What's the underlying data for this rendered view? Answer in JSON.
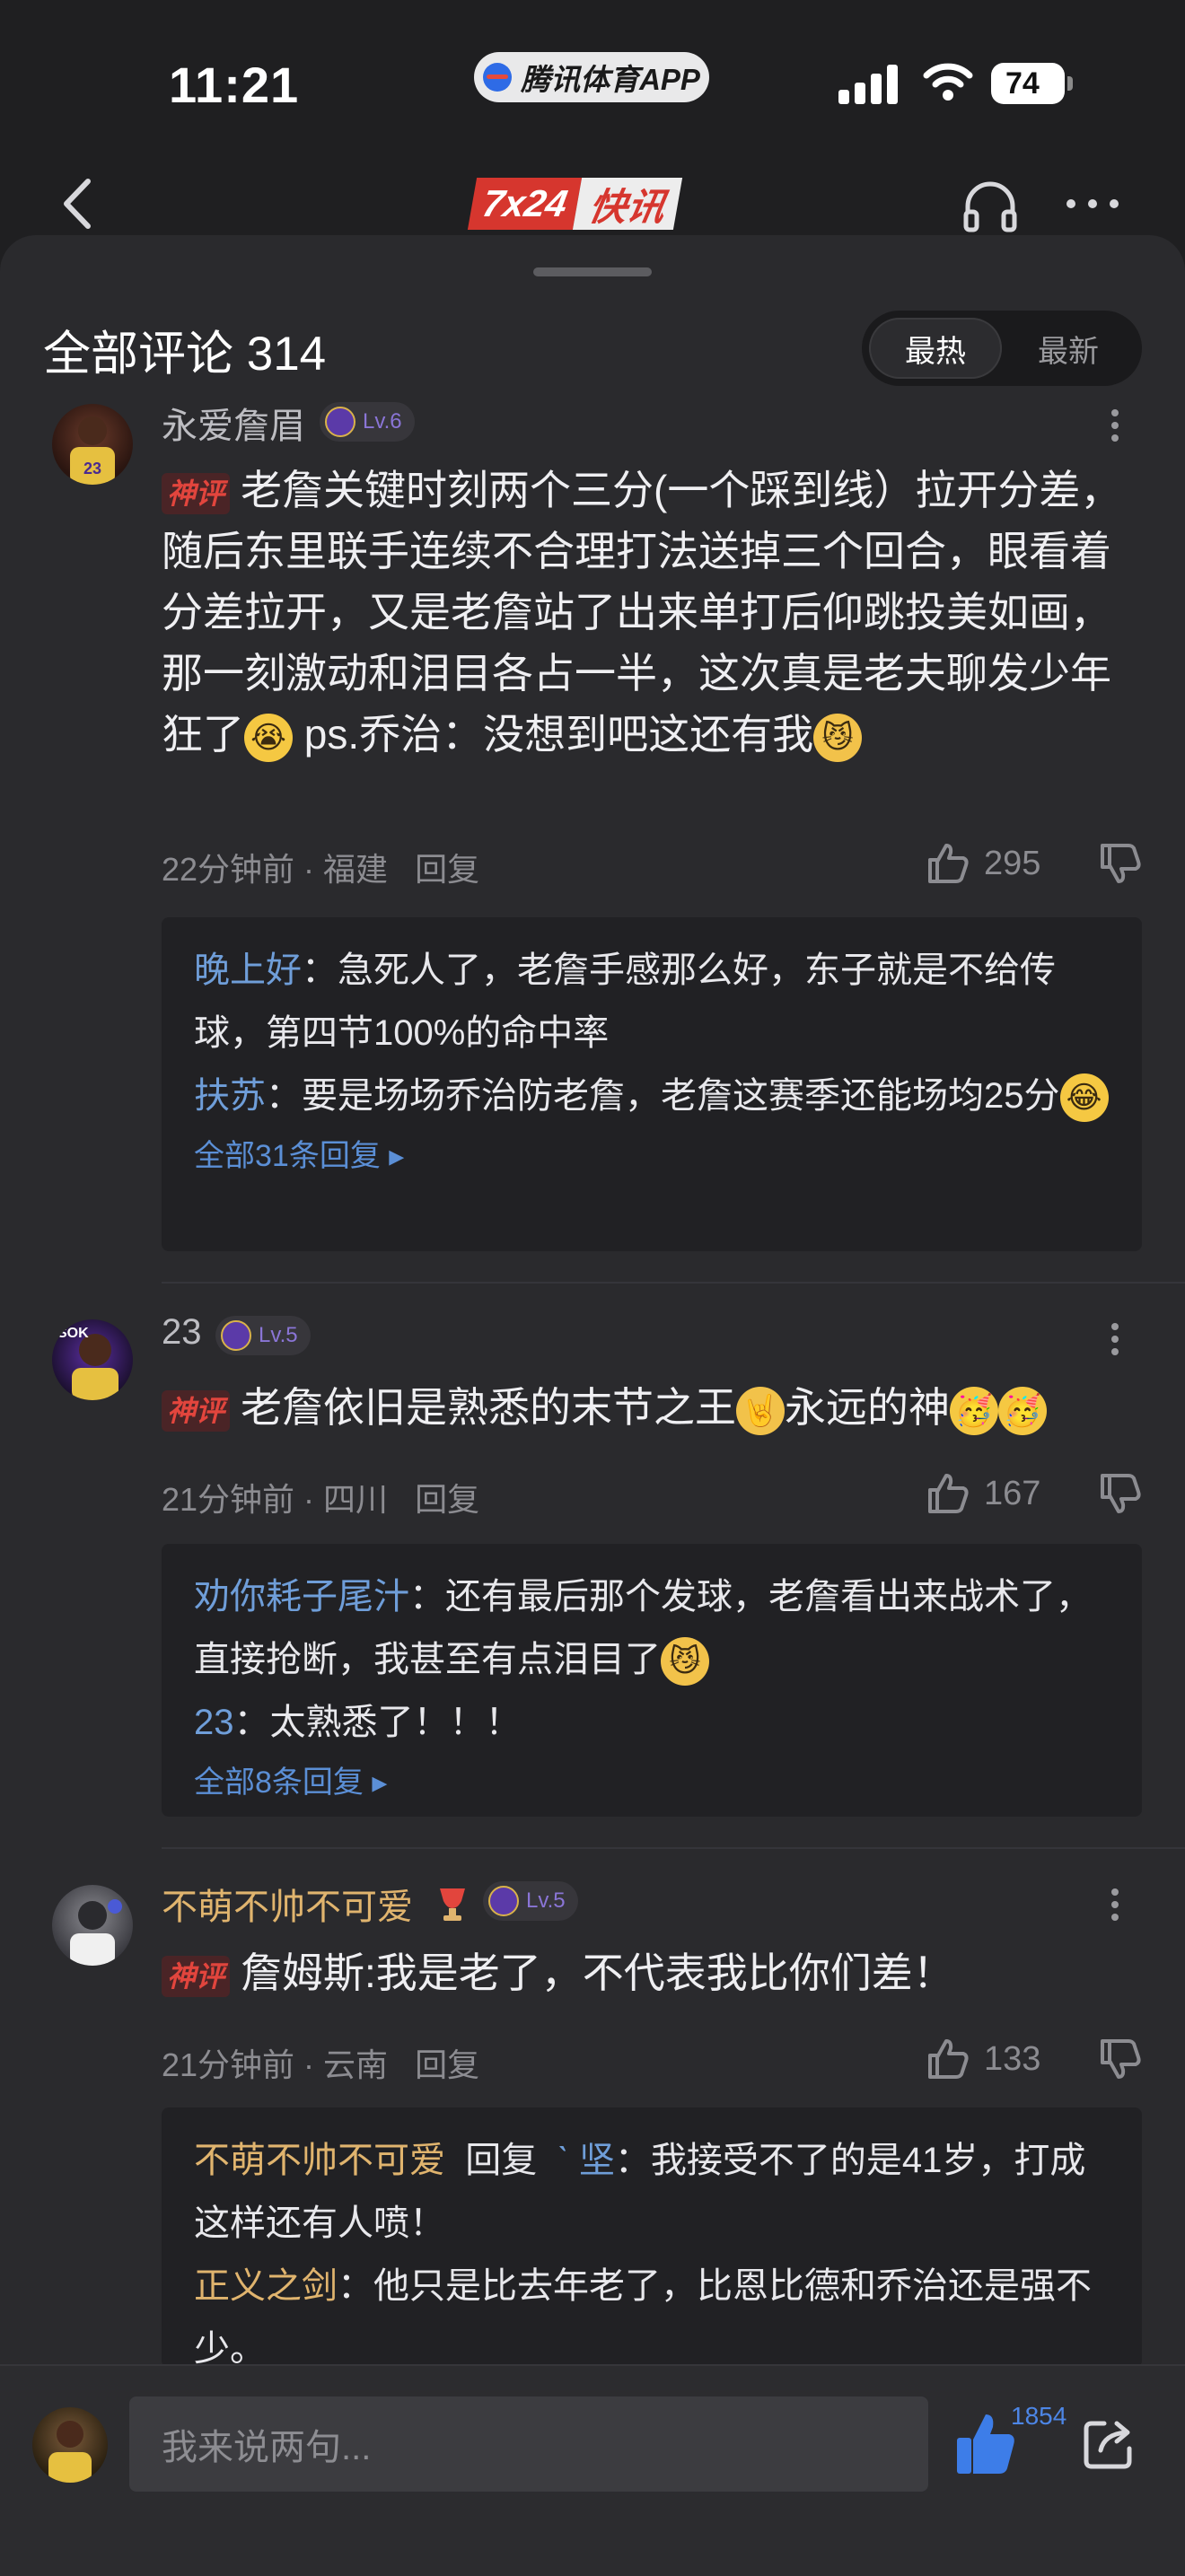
{
  "status": {
    "time": "11:21",
    "app_pill": "腾讯体育APP",
    "battery": "74"
  },
  "header": {
    "logo_left": "7x24",
    "logo_right": "快讯"
  },
  "sheet": {
    "title": "全部评论 314",
    "sort_hot": "最热",
    "sort_new": "最新"
  },
  "comments": [
    {
      "user": "永爱詹眉",
      "level": "Lv.6",
      "tag": "神评",
      "text": "老詹关键时刻两个三分(一个踩到线）拉开分差，随后东里联手连续不合理打法送掉三个回合，眼看着分差拉开，又是老詹站了出来单打后仰跳投美如画，那一刻激动和泪目各占一半，这次真是老夫聊发少年狂了",
      "text_tail": " ps.乔治：没想到吧这还有我",
      "time": "22分钟前",
      "location": "福建",
      "reply": "回复",
      "likes": "295",
      "replies": [
        {
          "name": "晚上好",
          "text": "急死人了，老詹手感那么好，东子就是不给传球，第四节100%的命中率"
        },
        {
          "name": "扶苏",
          "text": "要是场场乔治防老詹，老詹这赛季还能场均25分"
        }
      ],
      "more": "全部31条回复"
    },
    {
      "user": "23",
      "level": "Lv.5",
      "tag": "神评",
      "text": "老詹依旧是熟悉的末节之王",
      "text_tail": "永远的神",
      "time": "21分钟前",
      "location": "四川",
      "reply": "回复",
      "likes": "167",
      "replies": [
        {
          "name": "劝你耗子尾汁",
          "text": "还有最后那个发球，老詹看出来战术了，直接抢断，我甚至有点泪目了"
        },
        {
          "name": "23",
          "text": "太熟悉了！！！"
        }
      ],
      "more": "全部8条回复"
    },
    {
      "user": "不萌不帅不可爱",
      "level": "Lv.5",
      "tag": "神评",
      "text": "詹姆斯:我是老了，不代表我比你们差！",
      "time": "21分钟前",
      "location": "云南",
      "reply": "回复",
      "likes": "133",
      "replies": [
        {
          "name": "不萌不帅不可爱",
          "mid": "回复",
          "target": "ˋ  坚",
          "text": "我接受不了的是41岁，打成这样还有人喷！"
        },
        {
          "name": "正义之剑",
          "text": "他只是比去年老了，比恩比德和乔治还是强不少。"
        }
      ]
    }
  ],
  "footer": {
    "placeholder": "我来说两句...",
    "like_count": "1854"
  },
  "colors": {
    "background": "#1f1f21",
    "sheet": "#2a2a2d",
    "link_blue": "#5b8fd6",
    "gold_name": "#e0b46e",
    "tag_red": "#e2453d"
  }
}
